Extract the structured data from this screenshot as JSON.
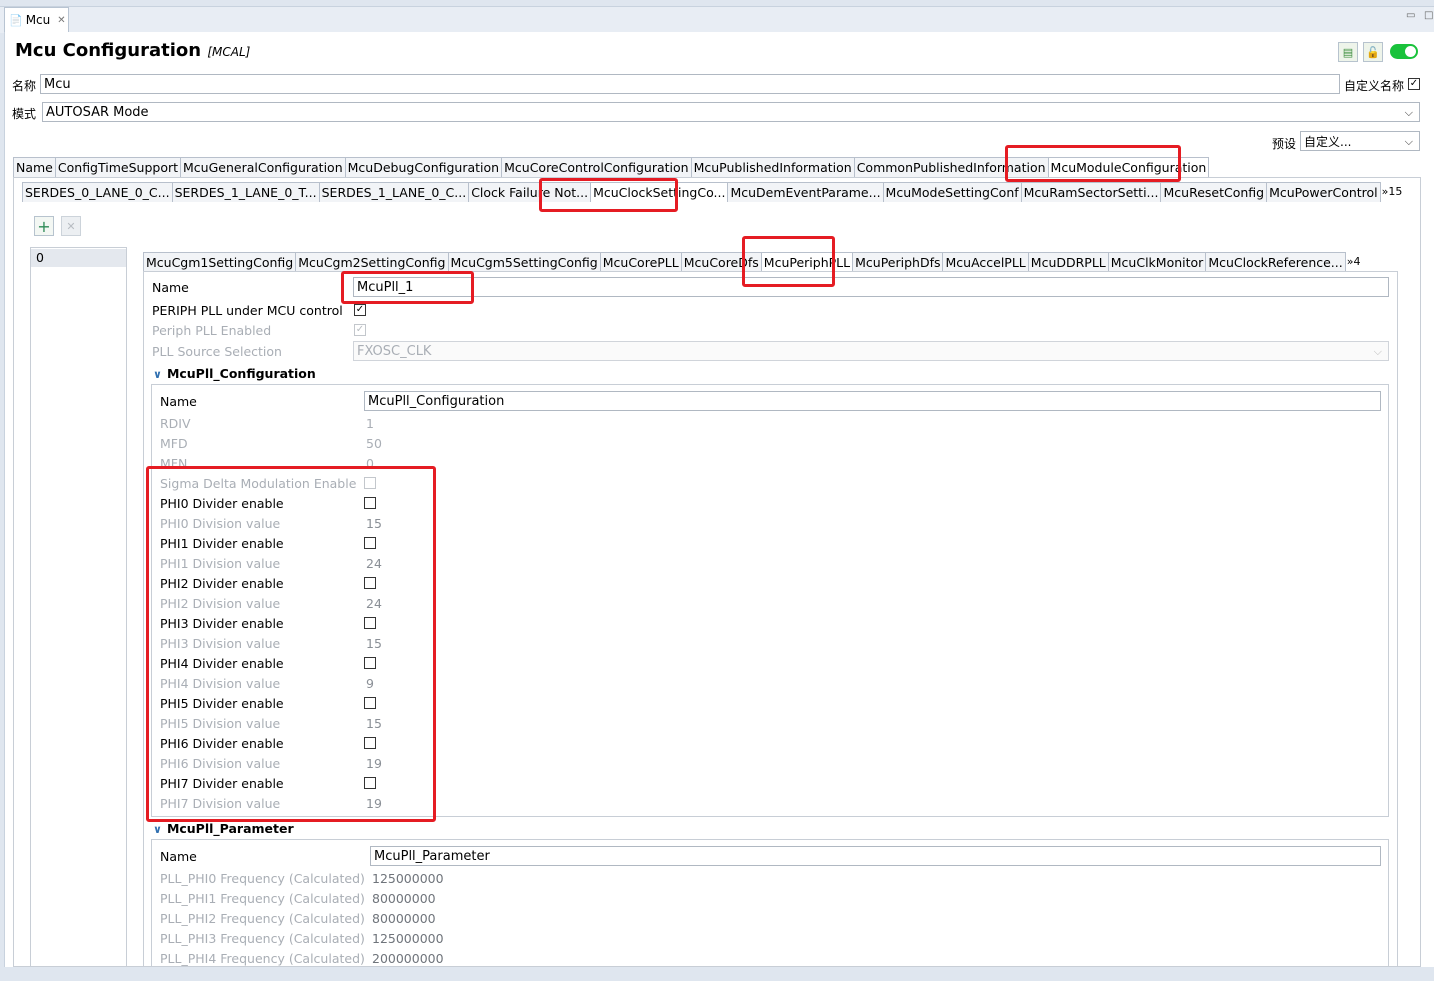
{
  "editor_tab": {
    "label": "Mcu"
  },
  "header": {
    "title": "Mcu Configuration",
    "subtitle": "[MCAL]"
  },
  "name_row": {
    "label": "名称",
    "value": "Mcu",
    "custom_name_label": "自定义名称",
    "custom_name_checked": true
  },
  "mode_row": {
    "label": "模式",
    "value": "AUTOSAR Mode"
  },
  "preset": {
    "label": "预设",
    "value": "自定义..."
  },
  "main_tabs": [
    "Name",
    "ConfigTimeSupport",
    "McuGeneralConfiguration",
    "McuDebugConfiguration",
    "McuCoreControlConfiguration",
    "McuPublishedInformation",
    "CommonPublishedInformation",
    "McuModuleConfiguration"
  ],
  "sub_tabs": [
    "SERDES_0_LANE_0_C...",
    "SERDES_1_LANE_0_T...",
    "SERDES_1_LANE_0_C...",
    "Clock Failure Not...",
    "McuClockSettingCo...",
    "McuDemEventParame...",
    "McuModeSettingConf",
    "McuRamSectorSetti...",
    "McuResetConfig",
    "McuPowerControl"
  ],
  "sub_tabs_more": "»15",
  "list": {
    "items": [
      "0"
    ],
    "add_label": "+",
    "remove_label": "✕"
  },
  "clock_tabs": [
    "McuCgm1SettingConfig",
    "McuCgm2SettingConfig",
    "McuCgm5SettingConfig",
    "McuCorePLL",
    "McuCoreDfs",
    "McuPeriphPLL",
    "McuPeriphDfs",
    "McuAccelPLL",
    "McuDDRPLL",
    "McuClkMonitor",
    "McuClockReference..."
  ],
  "clock_tabs_more": "»4",
  "pll": {
    "name_label": "Name",
    "name_value": "McuPll_1",
    "under_mcu_label": "PERIPH PLL under MCU control",
    "under_mcu_checked": true,
    "enabled_label": "Periph PLL Enabled",
    "enabled_checked": true,
    "source_label": "PLL Source Selection",
    "source_value": "FXOSC_CLK"
  },
  "pll_config": {
    "section_label": "McuPll_Configuration",
    "name_label": "Name",
    "name_value": "McuPll_Configuration",
    "rdiv_label": "RDIV",
    "rdiv_value": "1",
    "mfd_label": "MFD",
    "mfd_value": "50",
    "mfn_label": "MFN",
    "mfn_value": "0",
    "sigma_label": "Sigma Delta Modulation Enable",
    "phi": [
      {
        "enable_label": "PHI0 Divider enable",
        "value_label": "PHI0 Division value",
        "value": "15"
      },
      {
        "enable_label": "PHI1 Divider enable",
        "value_label": "PHI1 Division value",
        "value": "24"
      },
      {
        "enable_label": "PHI2 Divider enable",
        "value_label": "PHI2 Division value",
        "value": "24"
      },
      {
        "enable_label": "PHI3 Divider enable",
        "value_label": "PHI3 Division value",
        "value": "15"
      },
      {
        "enable_label": "PHI4 Divider enable",
        "value_label": "PHI4 Division value",
        "value": "9"
      },
      {
        "enable_label": "PHI5 Divider enable",
        "value_label": "PHI5 Division value",
        "value": "15"
      },
      {
        "enable_label": "PHI6 Divider enable",
        "value_label": "PHI6 Division value",
        "value": "19"
      },
      {
        "enable_label": "PHI7 Divider enable",
        "value_label": "PHI7 Division value",
        "value": "19"
      }
    ]
  },
  "pll_param": {
    "section_label": "McuPll_Parameter",
    "name_label": "Name",
    "name_value": "McuPll_Parameter",
    "freqs": [
      {
        "label": "PLL_PHI0 Frequency (Calculated)",
        "value": "125000000"
      },
      {
        "label": "PLL_PHI1 Frequency (Calculated)",
        "value": "80000000"
      },
      {
        "label": "PLL_PHI2 Frequency (Calculated)",
        "value": "80000000"
      },
      {
        "label": "PLL_PHI3 Frequency (Calculated)",
        "value": "125000000"
      },
      {
        "label": "PLL_PHI4 Frequency (Calculated)",
        "value": "200000000"
      }
    ]
  },
  "colors": {
    "highlight": "#e51c23",
    "toggle": "#19c23b"
  }
}
